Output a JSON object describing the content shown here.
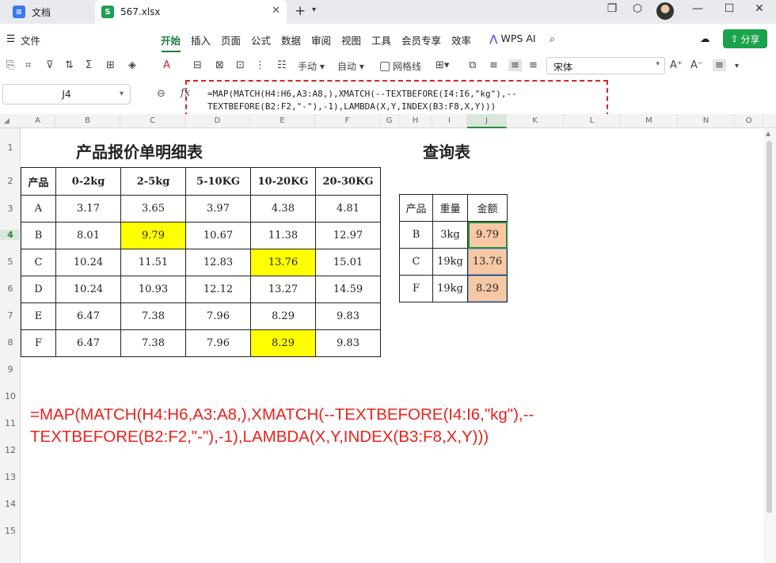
{
  "tabs": {
    "docs_label": "文档",
    "docs_icon": "docs-icon",
    "file_label": "567.xlsx",
    "file_icon": "S"
  },
  "menu": {
    "file_label": "文件",
    "items": [
      "开始",
      "插入",
      "页面",
      "公式",
      "数据",
      "审阅",
      "视图",
      "工具",
      "会员专享",
      "效率"
    ],
    "wps_ai": "WPS AI",
    "share": "分享"
  },
  "toolbar": {
    "manual_label": "手动",
    "auto_label": "自动",
    "wrap_label": "网格线",
    "font_name": "宋体"
  },
  "formula_bar": {
    "cell_ref": "J4",
    "formula_line1": "=MAP(MATCH(H4:H6,A3:A8,),XMATCH(--TEXTBEFORE(I4:I6,\"kg\"),--",
    "formula_line2": "TEXTBEFORE(B2:F2,\"-\"),-1),LAMBDA(X,Y,INDEX(B3:F8,X,Y)))"
  },
  "columns": [
    "A",
    "B",
    "C",
    "D",
    "E",
    "F",
    "G",
    "H",
    "I",
    "J",
    "K",
    "L",
    "M",
    "N",
    "O"
  ],
  "rows": [
    "1",
    "2",
    "3",
    "4",
    "5",
    "6",
    "7",
    "8",
    "9",
    "10",
    "11",
    "12",
    "13",
    "14",
    "15"
  ],
  "price_table": {
    "title": "产品报价单明细表",
    "headers": [
      "产品",
      "0-2kg",
      "2-5kg",
      "5-10KG",
      "10-20KG",
      "20-30KG"
    ],
    "rows": [
      [
        "A",
        "3.17",
        "3.65",
        "3.97",
        "4.38",
        "4.81"
      ],
      [
        "B",
        "8.01",
        "9.79",
        "10.67",
        "11.38",
        "12.97"
      ],
      [
        "C",
        "10.24",
        "11.51",
        "12.83",
        "13.76",
        "15.01"
      ],
      [
        "D",
        "10.24",
        "10.93",
        "12.12",
        "13.27",
        "14.59"
      ],
      [
        "E",
        "6.47",
        "7.38",
        "7.96",
        "8.29",
        "9.83"
      ],
      [
        "F",
        "6.47",
        "7.38",
        "7.96",
        "8.29",
        "9.83"
      ]
    ]
  },
  "query_table": {
    "title": "查询表",
    "headers": [
      "产品",
      "重量",
      "金额"
    ],
    "rows": [
      [
        "B",
        "3kg",
        "9.79"
      ],
      [
        "C",
        "19kg",
        "13.76"
      ],
      [
        "F",
        "19kg",
        "8.29"
      ]
    ]
  },
  "annotation": {
    "line1": "=MAP(MATCH(H4:H6,A3:A8,),XMATCH(--TEXTBEFORE(I4:I6,\"kg\"),--",
    "line2": "TEXTBEFORE(B2:F2,\"-\"),-1),LAMBDA(X,Y,INDEX(B3:F8,X,Y)))",
    "color": "#f0211a"
  },
  "colors": {
    "highlight": "#ffff00",
    "result_fill": "#f8c8a4",
    "accent": "#1a7f3c",
    "share": "#1aa34a"
  }
}
